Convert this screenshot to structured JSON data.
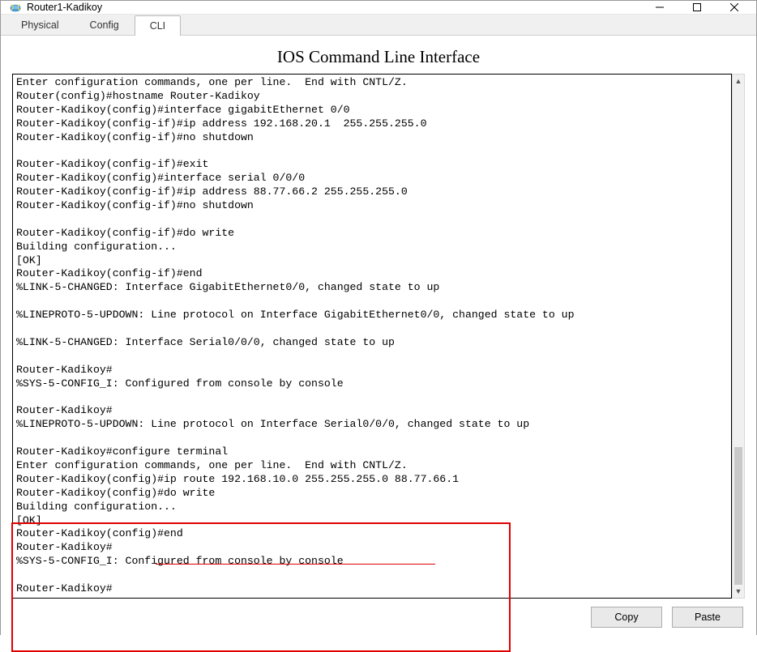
{
  "window": {
    "title": "Router1-Kadikoy"
  },
  "tabs": {
    "physical": "Physical",
    "config": "Config",
    "cli": "CLI"
  },
  "heading": "IOS Command Line Interface",
  "terminal_lines": [
    "Enter configuration commands, one per line.  End with CNTL/Z.",
    "Router(config)#hostname Router-Kadikoy",
    "Router-Kadikoy(config)#interface gigabitEthernet 0/0",
    "Router-Kadikoy(config-if)#ip address 192.168.20.1  255.255.255.0",
    "Router-Kadikoy(config-if)#no shutdown",
    "",
    "Router-Kadikoy(config-if)#exit",
    "Router-Kadikoy(config)#interface serial 0/0/0",
    "Router-Kadikoy(config-if)#ip address 88.77.66.2 255.255.255.0",
    "Router-Kadikoy(config-if)#no shutdown",
    "",
    "Router-Kadikoy(config-if)#do write",
    "Building configuration...",
    "[OK]",
    "Router-Kadikoy(config-if)#end",
    "%LINK-5-CHANGED: Interface GigabitEthernet0/0, changed state to up",
    "",
    "%LINEPROTO-5-UPDOWN: Line protocol on Interface GigabitEthernet0/0, changed state to up",
    "",
    "%LINK-5-CHANGED: Interface Serial0/0/0, changed state to up",
    "",
    "Router-Kadikoy#",
    "%SYS-5-CONFIG_I: Configured from console by console",
    "",
    "Router-Kadikoy#",
    "%LINEPROTO-5-UPDOWN: Line protocol on Interface Serial0/0/0, changed state to up",
    "",
    "Router-Kadikoy#configure terminal",
    "Enter configuration commands, one per line.  End with CNTL/Z.",
    "Router-Kadikoy(config)#ip route 192.168.10.0 255.255.255.0 88.77.66.1",
    "Router-Kadikoy(config)#do write",
    "Building configuration...",
    "[OK]",
    "Router-Kadikoy(config)#end",
    "Router-Kadikoy#",
    "%SYS-5-CONFIG_I: Configured from console by console",
    "",
    "Router-Kadikoy#"
  ],
  "buttons": {
    "copy": "Copy",
    "paste": "Paste"
  }
}
